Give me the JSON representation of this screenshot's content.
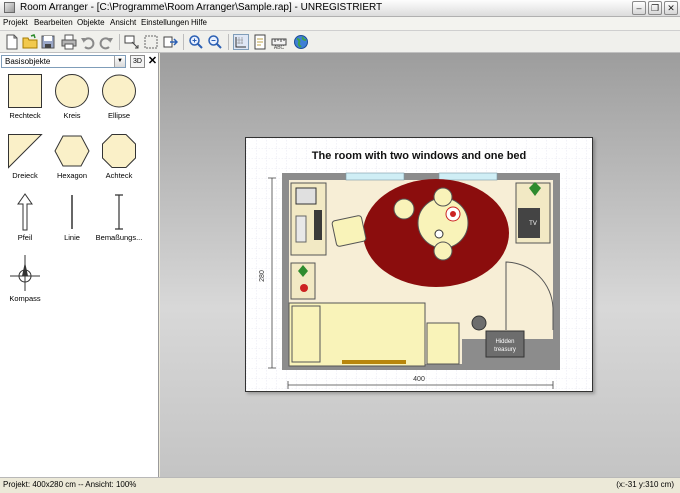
{
  "window": {
    "title": "Room Arranger - [C:\\Programme\\Room Arranger\\Sample.rap] - UNREGISTRIERT"
  },
  "menu": [
    "Projekt",
    "Bearbeiten",
    "Objekte",
    "Ansicht",
    "Einstellungen",
    "Hilfe"
  ],
  "toolbar_icons": [
    "new-file-icon",
    "open-folder-icon",
    "save-icon",
    "print-icon",
    "undo-icon",
    "redo-icon",
    "insert-object-icon",
    "select-icon",
    "export-icon",
    "zoom-in-icon",
    "zoom-out-icon",
    "grid-icon",
    "page-icon",
    "measure-icon",
    "globe-icon"
  ],
  "panel": {
    "category": "Basisobjekte",
    "btn_3d": "3D",
    "close": "✕",
    "shapes": [
      "Rechteck",
      "Kreis",
      "Ellipse",
      "Dreieck",
      "Hexagon",
      "Achteck",
      "Pfeil",
      "Linie",
      "Bemaßungs...",
      "Kompass"
    ]
  },
  "plan": {
    "title": "The room with two windows and one bed",
    "dim_vertical": "280",
    "dim_horizontal": "400",
    "label_tv": "TV",
    "label_treasury": "Hidden treasury",
    "colors": {
      "wall": "#8c8c8c",
      "floor": "#f7eed6",
      "carpet": "#8b0d0d",
      "bed": "#f9f3b9",
      "window": "#cfeef5",
      "plant": "#2e8b2e"
    }
  },
  "status": {
    "left": "Projekt: 400x280 cm -- Ansicht: 100%",
    "right": "(x:-31 y:310 cm)"
  }
}
